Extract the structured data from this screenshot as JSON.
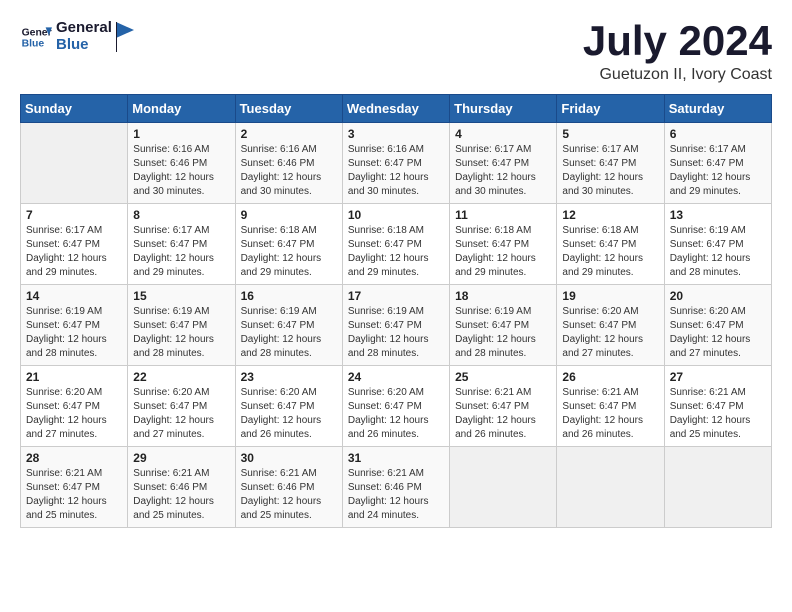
{
  "header": {
    "logo_line1": "General",
    "logo_line2": "Blue",
    "title": "July 2024",
    "subtitle": "Guetuzon II, Ivory Coast"
  },
  "weekdays": [
    "Sunday",
    "Monday",
    "Tuesday",
    "Wednesday",
    "Thursday",
    "Friday",
    "Saturday"
  ],
  "weeks": [
    [
      {
        "day": "",
        "sunrise": "",
        "sunset": "",
        "daylight": ""
      },
      {
        "day": "1",
        "sunrise": "6:16 AM",
        "sunset": "6:46 PM",
        "daylight": "12 hours and 30 minutes."
      },
      {
        "day": "2",
        "sunrise": "6:16 AM",
        "sunset": "6:46 PM",
        "daylight": "12 hours and 30 minutes."
      },
      {
        "day": "3",
        "sunrise": "6:16 AM",
        "sunset": "6:47 PM",
        "daylight": "12 hours and 30 minutes."
      },
      {
        "day": "4",
        "sunrise": "6:17 AM",
        "sunset": "6:47 PM",
        "daylight": "12 hours and 30 minutes."
      },
      {
        "day": "5",
        "sunrise": "6:17 AM",
        "sunset": "6:47 PM",
        "daylight": "12 hours and 30 minutes."
      },
      {
        "day": "6",
        "sunrise": "6:17 AM",
        "sunset": "6:47 PM",
        "daylight": "12 hours and 29 minutes."
      }
    ],
    [
      {
        "day": "7",
        "sunrise": "6:17 AM",
        "sunset": "6:47 PM",
        "daylight": "12 hours and 29 minutes."
      },
      {
        "day": "8",
        "sunrise": "6:17 AM",
        "sunset": "6:47 PM",
        "daylight": "12 hours and 29 minutes."
      },
      {
        "day": "9",
        "sunrise": "6:18 AM",
        "sunset": "6:47 PM",
        "daylight": "12 hours and 29 minutes."
      },
      {
        "day": "10",
        "sunrise": "6:18 AM",
        "sunset": "6:47 PM",
        "daylight": "12 hours and 29 minutes."
      },
      {
        "day": "11",
        "sunrise": "6:18 AM",
        "sunset": "6:47 PM",
        "daylight": "12 hours and 29 minutes."
      },
      {
        "day": "12",
        "sunrise": "6:18 AM",
        "sunset": "6:47 PM",
        "daylight": "12 hours and 29 minutes."
      },
      {
        "day": "13",
        "sunrise": "6:19 AM",
        "sunset": "6:47 PM",
        "daylight": "12 hours and 28 minutes."
      }
    ],
    [
      {
        "day": "14",
        "sunrise": "6:19 AM",
        "sunset": "6:47 PM",
        "daylight": "12 hours and 28 minutes."
      },
      {
        "day": "15",
        "sunrise": "6:19 AM",
        "sunset": "6:47 PM",
        "daylight": "12 hours and 28 minutes."
      },
      {
        "day": "16",
        "sunrise": "6:19 AM",
        "sunset": "6:47 PM",
        "daylight": "12 hours and 28 minutes."
      },
      {
        "day": "17",
        "sunrise": "6:19 AM",
        "sunset": "6:47 PM",
        "daylight": "12 hours and 28 minutes."
      },
      {
        "day": "18",
        "sunrise": "6:19 AM",
        "sunset": "6:47 PM",
        "daylight": "12 hours and 28 minutes."
      },
      {
        "day": "19",
        "sunrise": "6:20 AM",
        "sunset": "6:47 PM",
        "daylight": "12 hours and 27 minutes."
      },
      {
        "day": "20",
        "sunrise": "6:20 AM",
        "sunset": "6:47 PM",
        "daylight": "12 hours and 27 minutes."
      }
    ],
    [
      {
        "day": "21",
        "sunrise": "6:20 AM",
        "sunset": "6:47 PM",
        "daylight": "12 hours and 27 minutes."
      },
      {
        "day": "22",
        "sunrise": "6:20 AM",
        "sunset": "6:47 PM",
        "daylight": "12 hours and 27 minutes."
      },
      {
        "day": "23",
        "sunrise": "6:20 AM",
        "sunset": "6:47 PM",
        "daylight": "12 hours and 26 minutes."
      },
      {
        "day": "24",
        "sunrise": "6:20 AM",
        "sunset": "6:47 PM",
        "daylight": "12 hours and 26 minutes."
      },
      {
        "day": "25",
        "sunrise": "6:21 AM",
        "sunset": "6:47 PM",
        "daylight": "12 hours and 26 minutes."
      },
      {
        "day": "26",
        "sunrise": "6:21 AM",
        "sunset": "6:47 PM",
        "daylight": "12 hours and 26 minutes."
      },
      {
        "day": "27",
        "sunrise": "6:21 AM",
        "sunset": "6:47 PM",
        "daylight": "12 hours and 25 minutes."
      }
    ],
    [
      {
        "day": "28",
        "sunrise": "6:21 AM",
        "sunset": "6:47 PM",
        "daylight": "12 hours and 25 minutes."
      },
      {
        "day": "29",
        "sunrise": "6:21 AM",
        "sunset": "6:46 PM",
        "daylight": "12 hours and 25 minutes."
      },
      {
        "day": "30",
        "sunrise": "6:21 AM",
        "sunset": "6:46 PM",
        "daylight": "12 hours and 25 minutes."
      },
      {
        "day": "31",
        "sunrise": "6:21 AM",
        "sunset": "6:46 PM",
        "daylight": "12 hours and 24 minutes."
      },
      {
        "day": "",
        "sunrise": "",
        "sunset": "",
        "daylight": ""
      },
      {
        "day": "",
        "sunrise": "",
        "sunset": "",
        "daylight": ""
      },
      {
        "day": "",
        "sunrise": "",
        "sunset": "",
        "daylight": ""
      }
    ]
  ],
  "colors": {
    "header_bg": "#2563a8",
    "header_text": "#ffffff",
    "title_color": "#1a1a2e",
    "logo_blue": "#2563a8"
  }
}
